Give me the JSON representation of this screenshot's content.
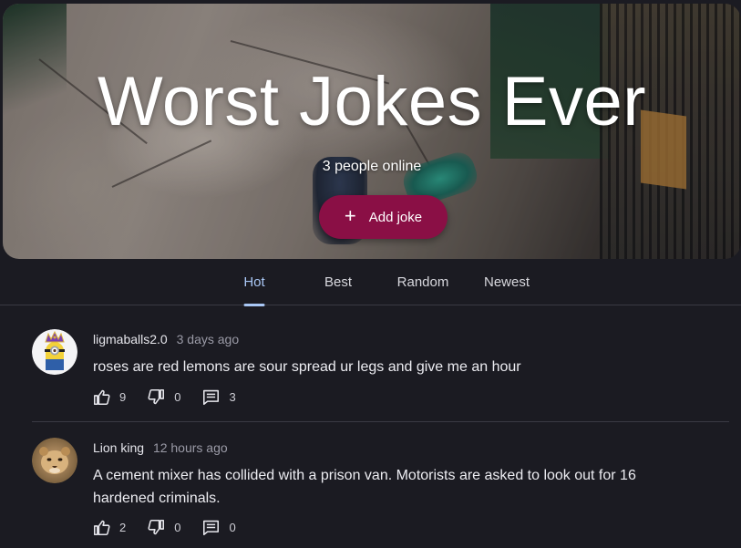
{
  "hero": {
    "title": "Worst Jokes Ever",
    "online_text": "3 people online",
    "add_button_label": "Add joke"
  },
  "tabs": [
    {
      "label": "Hot",
      "active": true
    },
    {
      "label": "Best",
      "active": false
    },
    {
      "label": "Random",
      "active": false
    },
    {
      "label": "Newest",
      "active": false
    }
  ],
  "posts": [
    {
      "author": "ligmaballs2.0",
      "time": "3 days ago",
      "avatar": "minion-with-crown-avatar",
      "text": "roses are red lemons are sour spread ur legs and give me an hour",
      "likes": "9",
      "dislikes": "0",
      "comments": "3"
    },
    {
      "author": "Lion king",
      "time": "12 hours ago",
      "avatar": "lion-cub-avatar",
      "text": "A cement mixer has collided with a prison van. Motorists are asked to look out for 16 hardened criminals.",
      "likes": "2",
      "dislikes": "0",
      "comments": "0"
    }
  ],
  "icons": {
    "add": "plus-icon",
    "like": "thumbs-up-icon",
    "dislike": "thumbs-down-icon",
    "comment": "comment-icon"
  },
  "colors": {
    "background": "#1b1b22",
    "accent_button": "#8a0f45",
    "active_tab": "#a9c7f5"
  }
}
